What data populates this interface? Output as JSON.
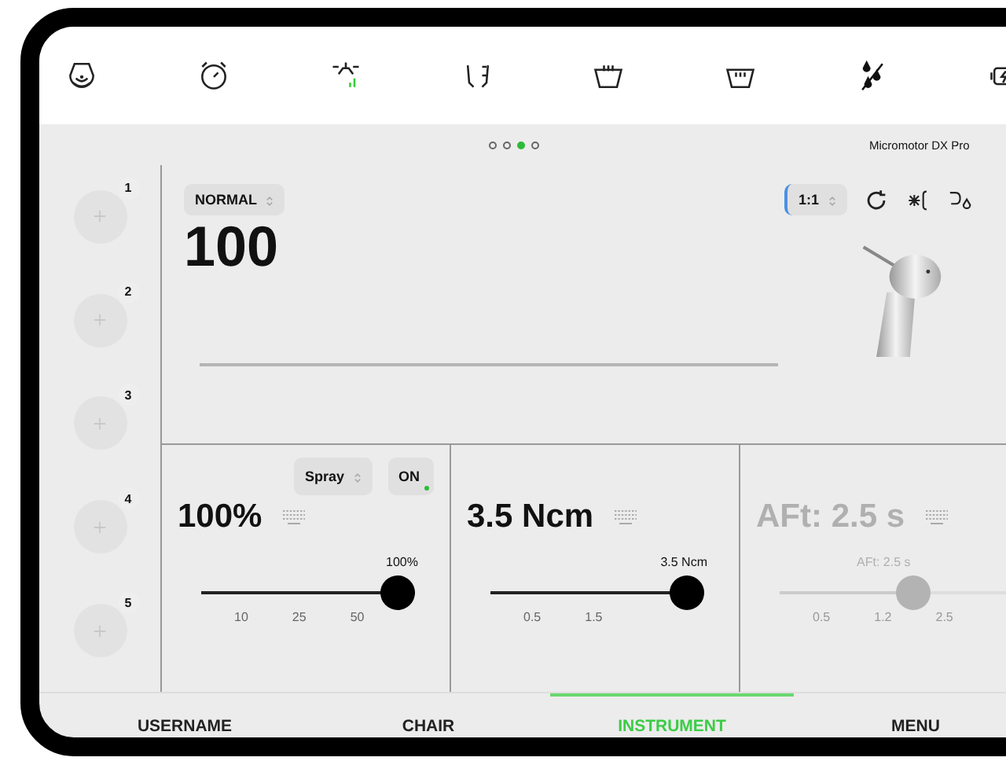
{
  "pager": {
    "dots": [
      {
        "selected": false
      },
      {
        "selected": false
      },
      {
        "selected": true
      },
      {
        "selected": false
      }
    ]
  },
  "instrument_name": "Micromotor DX Pro",
  "presets": [
    {
      "number": "1"
    },
    {
      "number": "2"
    },
    {
      "number": "3"
    },
    {
      "number": "4"
    },
    {
      "number": "5"
    }
  ],
  "main": {
    "mode": "NORMAL",
    "value": "100",
    "ratio": "1:1"
  },
  "controls": [
    {
      "select": "Spray",
      "toggle": {
        "label": "ON",
        "on": true
      },
      "value": "100%",
      "reading": "100%",
      "level": 1,
      "ticks": [
        "10",
        "25",
        "50"
      ],
      "disabled": false
    },
    {
      "value": "3.5 Ncm",
      "reading": "3.5 Ncm",
      "level": 1,
      "ticks": [
        "0.5",
        "1.5"
      ],
      "disabled": false
    },
    {
      "value": "AFt: 2.5 s",
      "reading": "AFt: 2.5 s",
      "level": 0.5,
      "ticks": [
        "0.5",
        "1.2",
        "2.5"
      ],
      "disabled": true
    }
  ],
  "nav": [
    {
      "label": "USERNAME",
      "selected": false
    },
    {
      "label": "CHAIR",
      "selected": false
    },
    {
      "label": "INSTRUMENT",
      "selected": true
    },
    {
      "label": "MENU",
      "selected": false
    }
  ]
}
